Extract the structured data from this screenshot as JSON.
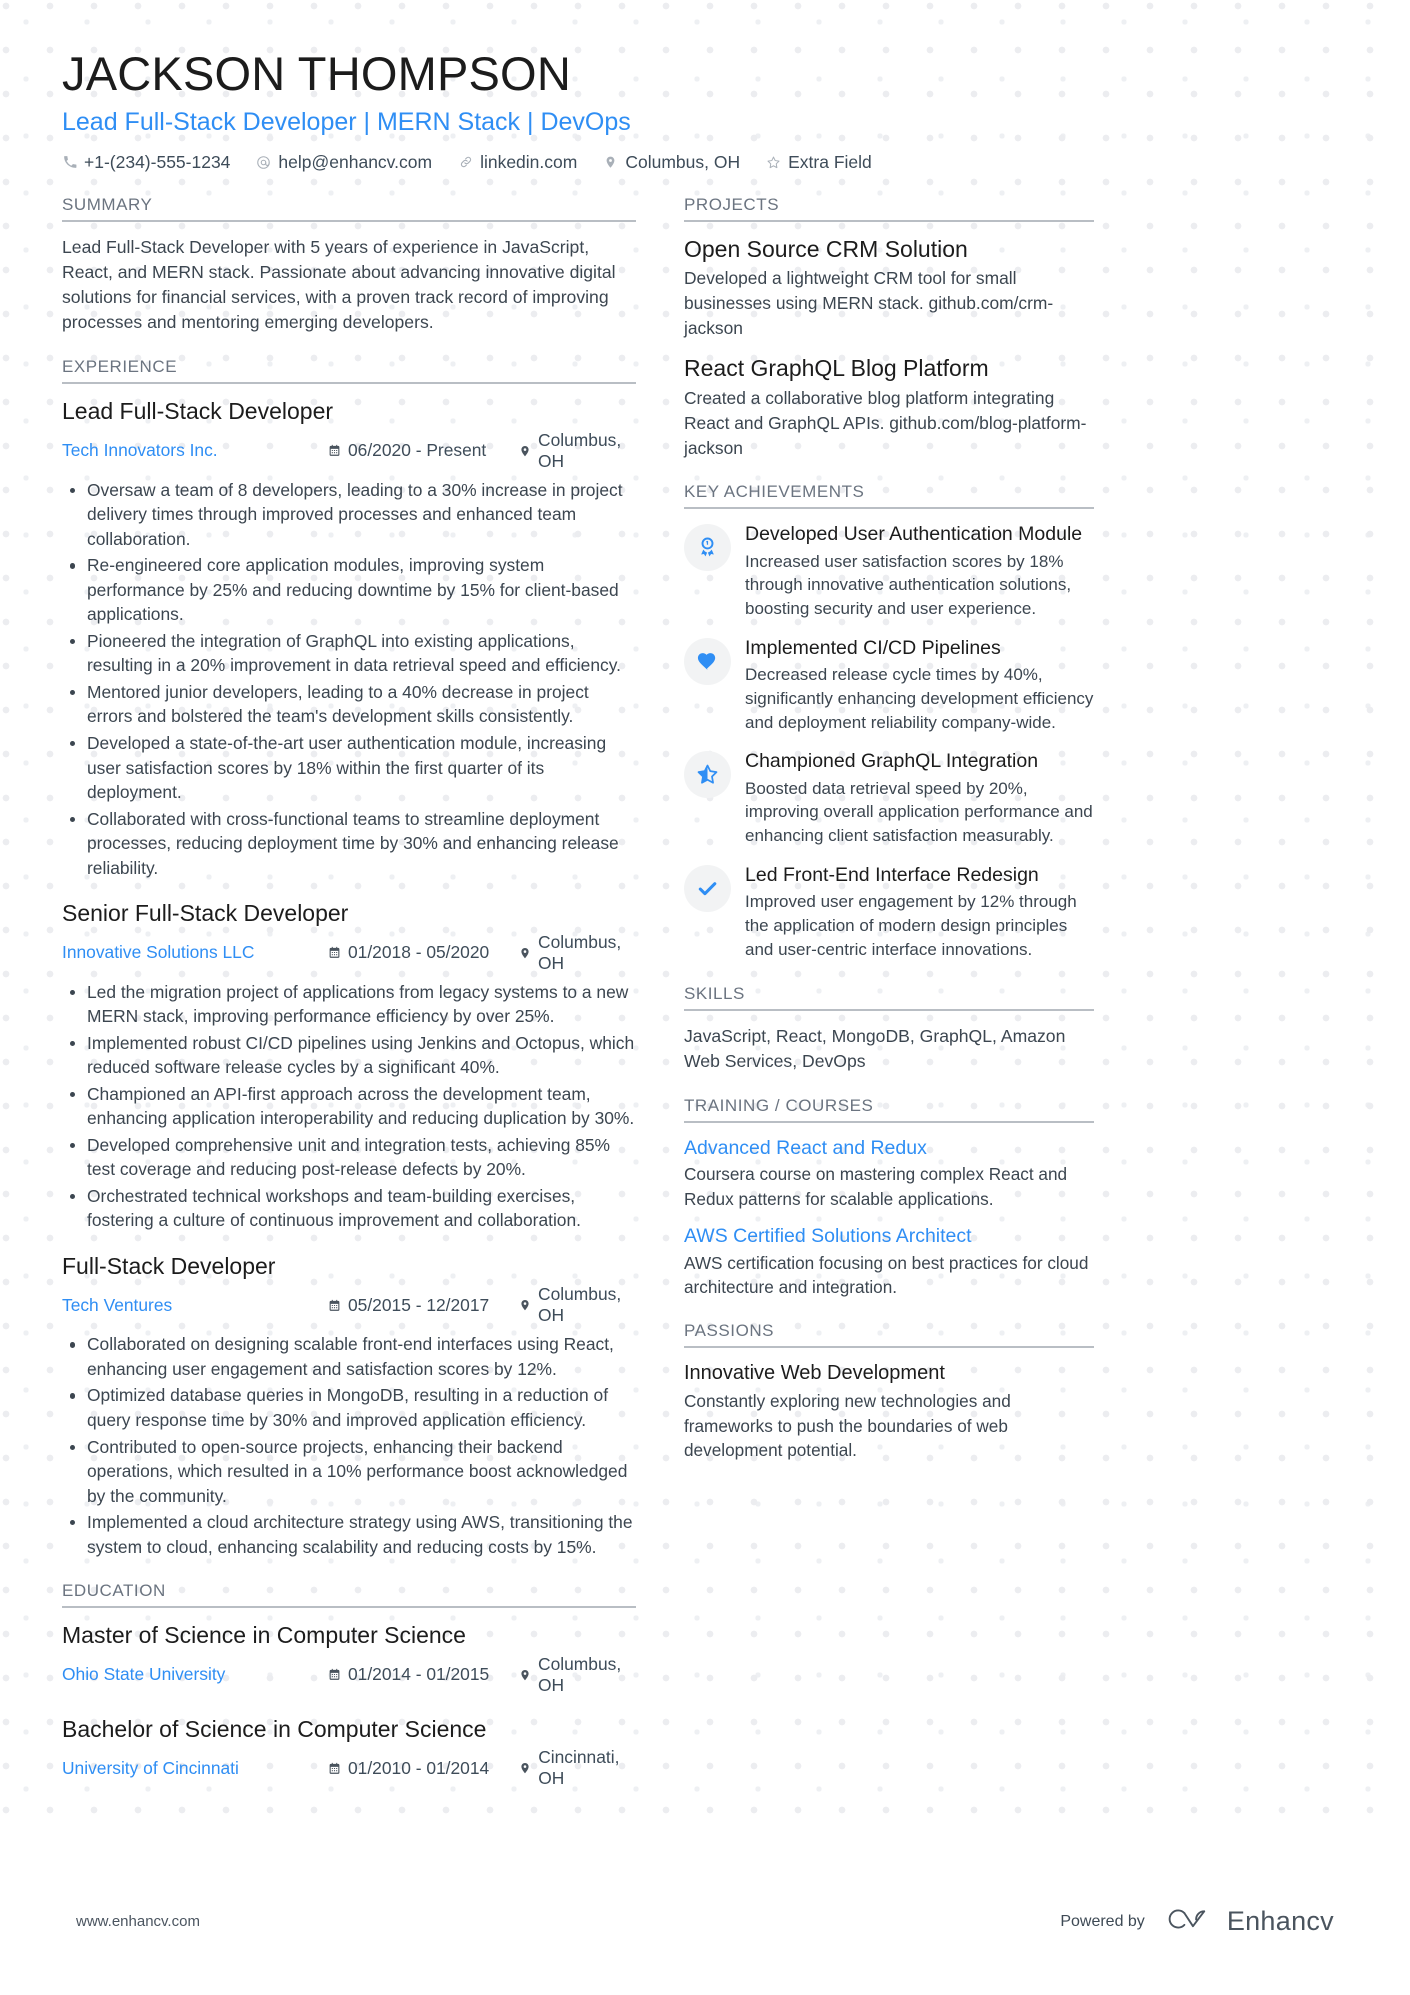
{
  "header": {
    "name": "JACKSON THOMPSON",
    "headline": "Lead Full-Stack Developer | MERN Stack | DevOps",
    "contacts": [
      {
        "icon": "phone-icon",
        "text": "+1-(234)-555-1234"
      },
      {
        "icon": "email-icon",
        "text": "help@enhancv.com"
      },
      {
        "icon": "link-icon",
        "text": "linkedin.com"
      },
      {
        "icon": "location-icon",
        "text": "Columbus, OH"
      },
      {
        "icon": "star-icon",
        "text": "Extra Field"
      }
    ]
  },
  "summary": {
    "title": "SUMMARY",
    "text": "Lead Full-Stack Developer with 5 years of experience in JavaScript, React, and MERN stack. Passionate about advancing innovative digital solutions for financial services, with a proven track record of improving processes and mentoring emerging developers."
  },
  "experience": {
    "title": "EXPERIENCE",
    "entries": [
      {
        "role": "Lead Full-Stack Developer",
        "company": "Tech Innovators Inc.",
        "dates": "06/2020 - Present",
        "location": "Columbus, OH",
        "bullets": [
          "Oversaw a team of 8 developers, leading to a 30% increase in project delivery times through improved processes and enhanced team collaboration.",
          "Re-engineered core application modules, improving system performance by 25% and reducing downtime by 15% for client-based applications.",
          "Pioneered the integration of GraphQL into existing applications, resulting in a 20% improvement in data retrieval speed and efficiency.",
          "Mentored junior developers, leading to a 40% decrease in project errors and bolstered the team's development skills consistently.",
          "Developed a state-of-the-art user authentication module, increasing user satisfaction scores by 18% within the first quarter of its deployment.",
          "Collaborated with cross-functional teams to streamline deployment processes, reducing deployment time by 30% and enhancing release reliability."
        ]
      },
      {
        "role": "Senior Full-Stack Developer",
        "company": "Innovative Solutions LLC",
        "dates": "01/2018 - 05/2020",
        "location": "Columbus, OH",
        "bullets": [
          "Led the migration project of applications from legacy systems to a new MERN stack, improving performance efficiency by over 25%.",
          "Implemented robust CI/CD pipelines using Jenkins and Octopus, which reduced software release cycles by a significant 40%.",
          "Championed an API-first approach across the development team, enhancing application interoperability and reducing duplication by 30%.",
          "Developed comprehensive unit and integration tests, achieving 85% test coverage and reducing post-release defects by 20%.",
          "Orchestrated technical workshops and team-building exercises, fostering a culture of continuous improvement and collaboration."
        ]
      },
      {
        "role": "Full-Stack Developer",
        "company": "Tech Ventures",
        "dates": "05/2015 - 12/2017",
        "location": "Columbus, OH",
        "bullets": [
          "Collaborated on designing scalable front-end interfaces using React, enhancing user engagement and satisfaction scores by 12%.",
          "Optimized database queries in MongoDB, resulting in a reduction of query response time by 30% and improved application efficiency.",
          "Contributed to open-source projects, enhancing their backend operations, which resulted in a 10% performance boost acknowledged by the community.",
          "Implemented a cloud architecture strategy using AWS, transitioning the system to cloud, enhancing scalability and reducing costs by 15%."
        ]
      }
    ]
  },
  "education": {
    "title": "EDUCATION",
    "entries": [
      {
        "degree": "Master of Science in Computer Science",
        "school": "Ohio State University",
        "dates": "01/2014 - 01/2015",
        "location": "Columbus, OH"
      },
      {
        "degree": "Bachelor of Science in Computer Science",
        "school": "University of Cincinnati",
        "dates": "01/2010 - 01/2014",
        "location": "Cincinnati, OH"
      }
    ]
  },
  "projects": {
    "title": "PROJECTS",
    "items": [
      {
        "name": "Open Source CRM Solution",
        "description": "Developed a lightweight CRM tool for small businesses using MERN stack. github.com/crm-jackson"
      },
      {
        "name": "React GraphQL Blog Platform",
        "description": "Created a collaborative blog platform integrating React and GraphQL APIs. github.com/blog-platform-jackson"
      }
    ]
  },
  "key_achievements": {
    "title": "KEY ACHIEVEMENTS",
    "items": [
      {
        "icon": "award-medal-icon",
        "name": "Developed User Authentication Module",
        "description": "Increased user satisfaction scores by 18% through innovative authentication solutions, boosting security and user experience."
      },
      {
        "icon": "heart-icon",
        "name": "Implemented CI/CD Pipelines",
        "description": "Decreased release cycle times by 40%, significantly enhancing development efficiency and deployment reliability company-wide."
      },
      {
        "icon": "half-star-icon",
        "name": "Championed GraphQL Integration",
        "description": "Boosted data retrieval speed by 20%, improving overall application performance and enhancing client satisfaction measurably."
      },
      {
        "icon": "check-icon",
        "name": "Led Front-End Interface Redesign",
        "description": "Improved user engagement by 12% through the application of modern design principles and user-centric interface innovations."
      }
    ]
  },
  "skills": {
    "title": "SKILLS",
    "text": "JavaScript, React, MongoDB, GraphQL, Amazon Web Services, DevOps"
  },
  "training": {
    "title": "TRAINING / COURSES",
    "items": [
      {
        "name": "Advanced React and Redux",
        "description": "Coursera course on mastering complex React and Redux patterns for scalable applications."
      },
      {
        "name": "AWS Certified Solutions Architect",
        "description": "AWS certification focusing on best practices for cloud architecture and integration."
      }
    ]
  },
  "passions": {
    "title": "PASSIONS",
    "items": [
      {
        "name": "Innovative Web Development",
        "description": "Constantly exploring new technologies and frameworks to push the boundaries of web development potential."
      }
    ]
  },
  "footer": {
    "url": "www.enhancv.com",
    "powered_by": "Powered by",
    "brand": "Enhancv"
  },
  "colors": {
    "accent": "#2f8ef4",
    "text": "#3c4650",
    "heading": "#1c1c1c",
    "section_label": "#6b7480"
  }
}
